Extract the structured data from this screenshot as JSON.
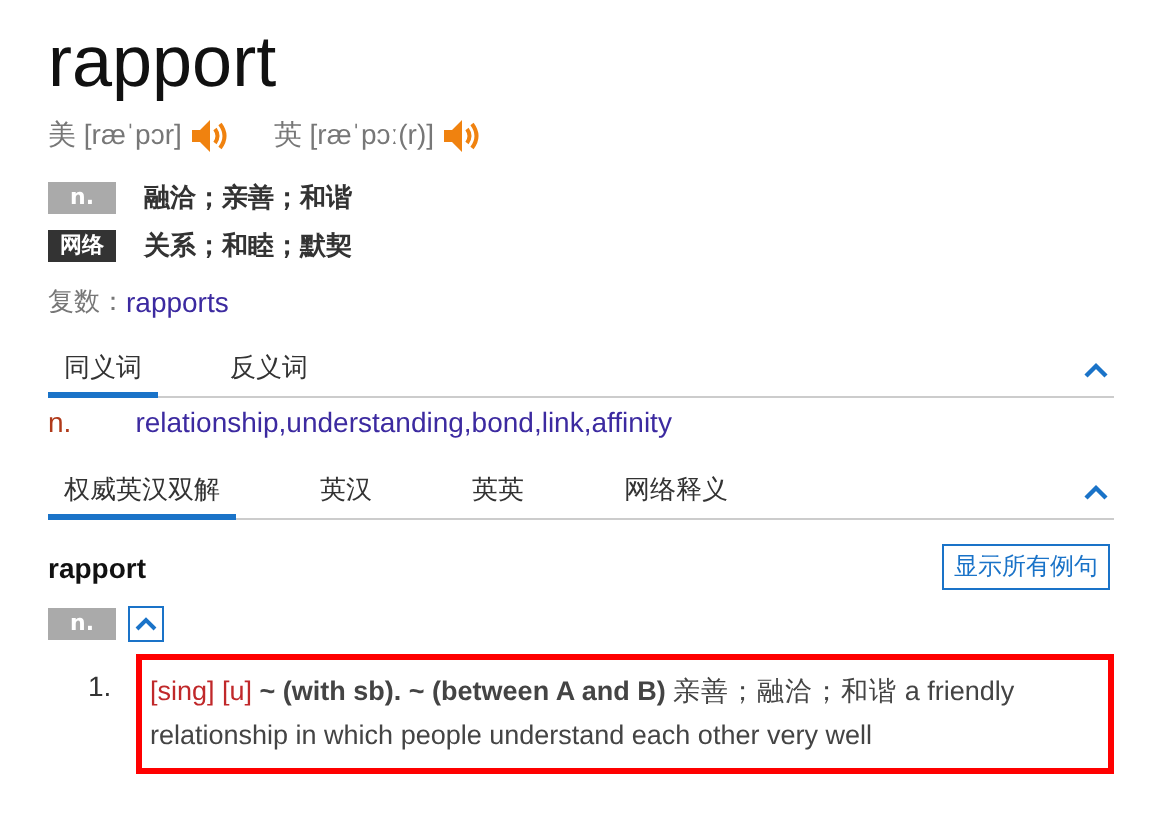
{
  "word": "rapport",
  "pronunciations": [
    {
      "region": "美",
      "ipa": "[ræˈpɔr]"
    },
    {
      "region": "英",
      "ipa": "[ræˈpɔː(r)]"
    }
  ],
  "senses": [
    {
      "kind": "pos",
      "tag": "n.",
      "text": "融洽；亲善；和谐"
    },
    {
      "kind": "web",
      "tag": "网络",
      "text": "关系；和睦；默契"
    }
  ],
  "plural": {
    "label": "复数：",
    "value": "rapports"
  },
  "synonym_tabs": {
    "tabs": [
      {
        "label": "同义词",
        "selected": true
      },
      {
        "label": "反义词",
        "selected": false
      }
    ],
    "expanded": true,
    "rows": [
      {
        "pos": "n.",
        "words": "relationship,understanding,bond,link,affinity"
      }
    ]
  },
  "definition_tabs": {
    "tabs": [
      {
        "label": "权威英汉双解",
        "selected": true
      },
      {
        "label": "英汉",
        "selected": false
      },
      {
        "label": "英英",
        "selected": false
      },
      {
        "label": "网络释义",
        "selected": false
      }
    ],
    "expanded": true
  },
  "entry": {
    "headword": "rapport",
    "show_examples_button": "显示所有例句",
    "pos": "n.",
    "expanded": true,
    "definitions": [
      {
        "number": "1.",
        "labels": [
          "[sing]",
          "[u]"
        ],
        "text": "**~ (with sb). ~ (between A and B)** 亲善；融洽；和谐 a friendly relationship in which people understand each other very well",
        "highlighted": true
      }
    ]
  }
}
